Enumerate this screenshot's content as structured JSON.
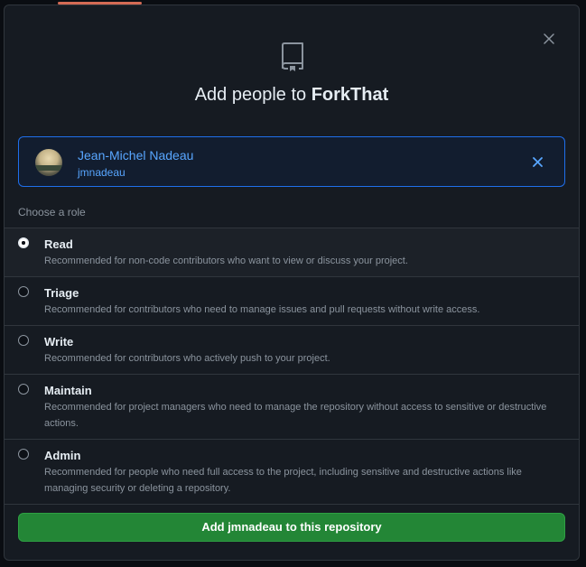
{
  "dialog": {
    "title_prefix": "Add people to ",
    "repo_name": "ForkThat",
    "close_label": "×"
  },
  "user": {
    "name": "Jean-Michel Nadeau",
    "login": "jmnadeau"
  },
  "role_heading": "Choose a role",
  "roles": [
    {
      "name": "Read",
      "desc": "Recommended for non-code contributors who want to view or discuss your project.",
      "selected": true
    },
    {
      "name": "Triage",
      "desc": "Recommended for contributors who need to manage issues and pull requests without write access.",
      "selected": false
    },
    {
      "name": "Write",
      "desc": "Recommended for contributors who actively push to your project.",
      "selected": false
    },
    {
      "name": "Maintain",
      "desc": "Recommended for project managers who need to manage the repository without access to sensitive or destructive actions.",
      "selected": false
    },
    {
      "name": "Admin",
      "desc": "Recommended for people who need full access to the project, including sensitive and destructive actions like managing security or deleting a repository.",
      "selected": false
    }
  ],
  "submit_label": "Add jmnadeau to this repository",
  "colors": {
    "accent": "#58a6ff",
    "primary_button": "#238636",
    "dialog_bg": "#161b22"
  }
}
